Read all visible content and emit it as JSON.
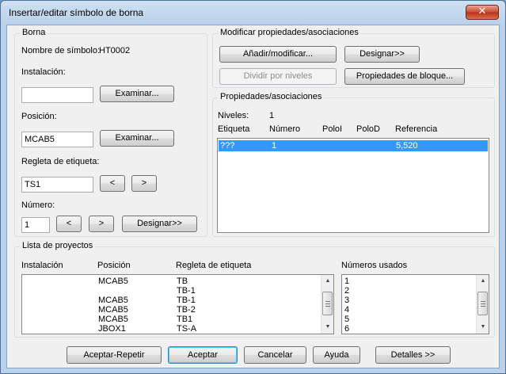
{
  "window": {
    "title": "Insertar/editar símbolo de borna",
    "close_glyph": "✕"
  },
  "borna": {
    "group_title": "Borna",
    "symbol_name_label": "Nombre de símbolo:",
    "symbol_name_value": "HT0002",
    "installation_label": "Instalación:",
    "installation_value": "",
    "browse_label": "Examinar...",
    "position_label": "Posición:",
    "position_value": "MCAB5",
    "strip_label": "Regleta de etiqueta:",
    "strip_value": "TS1",
    "prev_label": "<",
    "next_label": ">",
    "number_label": "Número:",
    "number_value": "1",
    "assign_label": "Designar>>"
  },
  "modify": {
    "group_title": "Modificar propiedades/asociaciones",
    "add_modify_label": "Añadir/modificar...",
    "assign_label": "Designar>>",
    "split_levels_label": "Dividir por niveles",
    "block_props_label": "Propiedades de bloque..."
  },
  "props": {
    "group_title": "Propiedades/asociaciones",
    "levels_label": "Niveles:",
    "levels_value": "1",
    "columns": [
      "Etiqueta",
      "Número",
      "PoloI",
      "PoloD",
      "Referencia"
    ],
    "rows": [
      {
        "etiqueta": "???",
        "numero": "1",
        "poloi": "",
        "polod": "",
        "referencia": "5,520"
      }
    ]
  },
  "projects": {
    "group_title": "Lista de proyectos",
    "columns": [
      "Instalación",
      "Posición",
      "Regleta de etiqueta"
    ],
    "rows": [
      {
        "instalacion": "",
        "posicion": "MCAB5",
        "regleta": "TB"
      },
      {
        "instalacion": "",
        "posicion": "",
        "regleta": "TB-1"
      },
      {
        "instalacion": "",
        "posicion": "MCAB5",
        "regleta": "TB-1"
      },
      {
        "instalacion": "",
        "posicion": "MCAB5",
        "regleta": "TB-2"
      },
      {
        "instalacion": "",
        "posicion": "MCAB5",
        "regleta": "TB1"
      },
      {
        "instalacion": "",
        "posicion": "JBOX1",
        "regleta": "TS-A"
      }
    ],
    "used_numbers_label": "Números usados",
    "used_numbers": [
      "1",
      "2",
      "3",
      "4",
      "5",
      "6"
    ]
  },
  "footer": {
    "accept_repeat": "Aceptar-Repetir",
    "accept": "Aceptar",
    "cancel": "Cancelar",
    "help": "Ayuda",
    "details": "Detalles >>"
  }
}
